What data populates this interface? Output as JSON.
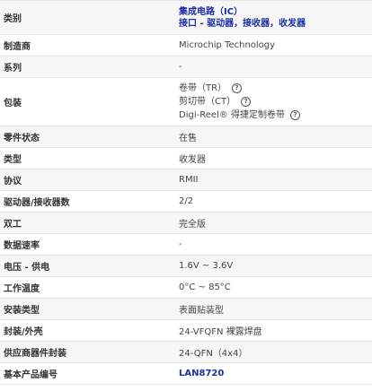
{
  "rows": [
    {
      "label": "类别",
      "values": [
        "集成电路（IC）",
        "接口 - 驱动器，接收器，收发器"
      ]
    },
    {
      "label": "制造商",
      "value": "Microchip Technology"
    },
    {
      "label": "系列",
      "value": "-"
    },
    {
      "label": "包装",
      "values": [
        "卷带（TR）",
        "剪切带（CT）",
        "Digi-Reel® 得捷定制卷带"
      ]
    },
    {
      "label": "零件状态",
      "value": "在售"
    },
    {
      "label": "类型",
      "value": "收发器"
    },
    {
      "label": "协议",
      "value": "RMII"
    },
    {
      "label": "驱动器/接收器数",
      "value": "2/2"
    },
    {
      "label": "双工",
      "value": "完全版"
    },
    {
      "label": "数据速率",
      "value": "-"
    },
    {
      "label": "电压 - 供电",
      "value": "1.6V ~ 3.6V"
    },
    {
      "label": "工作温度",
      "value": "0°C ~ 85°C"
    },
    {
      "label": "安装类型",
      "value": "表面贴装型"
    },
    {
      "label": "封装/外壳",
      "value": "24-VFQFN 裸露焊盘"
    },
    {
      "label": "供应商器件封装",
      "value": "24-QFN（4x4）"
    },
    {
      "label": "基本产品编号",
      "value": "LAN8720"
    }
  ],
  "help_icon": "question-circle-icon",
  "help_glyph": "?",
  "colors": {
    "link": "#1a2fa3",
    "row_alt": "#f6f6f6",
    "border": "#e6e6e6"
  }
}
